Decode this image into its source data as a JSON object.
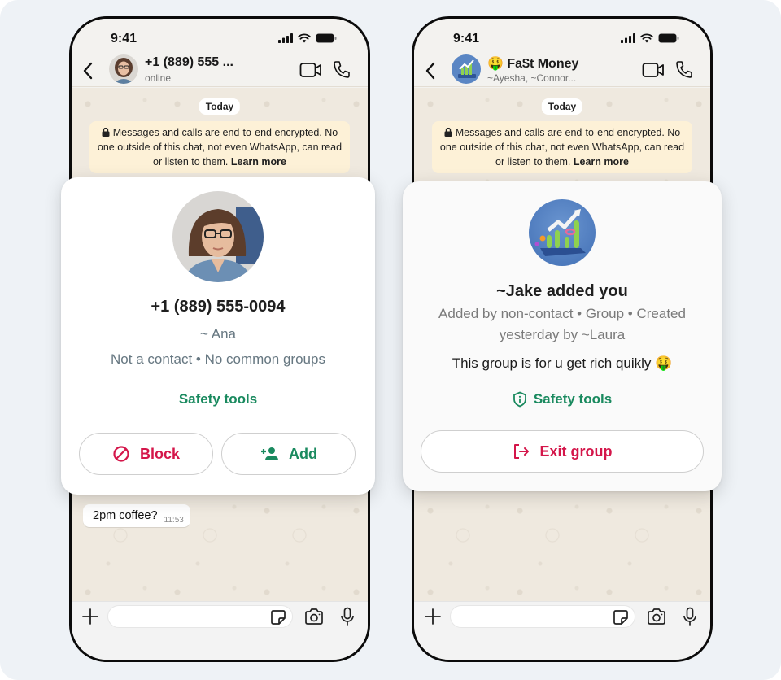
{
  "colors": {
    "background": "#eef2f6",
    "chat_wallpaper": "#efe9df",
    "encryption_banner": "#fdf1d7",
    "accent_green": "#1a8a5f",
    "danger_red": "#d4164a",
    "secondary_text": "#667781"
  },
  "phones": [
    {
      "status_bar": {
        "time": "9:41",
        "icons": [
          "cellular-signal-icon",
          "wifi-icon",
          "battery-icon"
        ]
      },
      "header": {
        "back_icon": "chevron-left-icon",
        "avatar": "contact-photo",
        "title": "+1 (889) 555 ...",
        "subtitle": "online",
        "actions": [
          "video-call-icon",
          "voice-call-icon"
        ]
      },
      "chat": {
        "date_chip": "Today",
        "encryption_notice": {
          "icon": "lock-icon",
          "text": "Messages and calls are end-to-end encrypted. No one outside of this chat, not even WhatsApp, can read or listen to them.",
          "link": "Learn more"
        },
        "messages": [
          {
            "text": "2pm coffee?",
            "time": "11:53",
            "direction": "incoming"
          }
        ]
      },
      "card": {
        "type": "unknown-contact",
        "avatar": "contact-photo",
        "title": "+1 (889) 555-0094",
        "name_line": "~ Ana",
        "info_line": "Not a contact • No common groups",
        "safety_tools": "Safety tools",
        "buttons": [
          {
            "label": "Block",
            "icon": "block-icon",
            "style": "danger"
          },
          {
            "label": "Add",
            "icon": "add-person-icon",
            "style": "accent"
          }
        ]
      },
      "composer": {
        "placeholder": "",
        "value": "",
        "icons": [
          "plus-icon",
          "sticker-icon",
          "camera-icon",
          "microphone-icon"
        ]
      }
    },
    {
      "status_bar": {
        "time": "9:41",
        "icons": [
          "cellular-signal-icon",
          "wifi-icon",
          "battery-icon"
        ]
      },
      "header": {
        "back_icon": "chevron-left-icon",
        "avatar": "group-chart-image",
        "title": "🤑 Fa$t Money",
        "subtitle": "~Ayesha, ~Connor...",
        "actions": [
          "video-call-icon",
          "voice-call-icon"
        ]
      },
      "chat": {
        "date_chip": "Today",
        "encryption_notice": {
          "icon": "lock-icon",
          "text": "Messages and calls are end-to-end encrypted. No one outside of this chat, not even WhatsApp, can read or listen to them.",
          "link": "Learn more"
        },
        "messages": []
      },
      "card": {
        "type": "unknown-group",
        "avatar": "group-chart-image",
        "title": "~Jake added you",
        "info_line_1": "Added by non-contact • Group • Created",
        "info_line_2": "yesterday by ~Laura",
        "description": "This group is for u get rich quikly 🤑",
        "safety_tools": "Safety tools",
        "safety_icon": "shield-info-icon",
        "buttons": [
          {
            "label": "Exit group",
            "icon": "exit-icon",
            "style": "danger"
          }
        ]
      },
      "composer": {
        "placeholder": "",
        "value": "",
        "icons": [
          "plus-icon",
          "sticker-icon",
          "camera-icon",
          "microphone-icon"
        ]
      }
    }
  ]
}
